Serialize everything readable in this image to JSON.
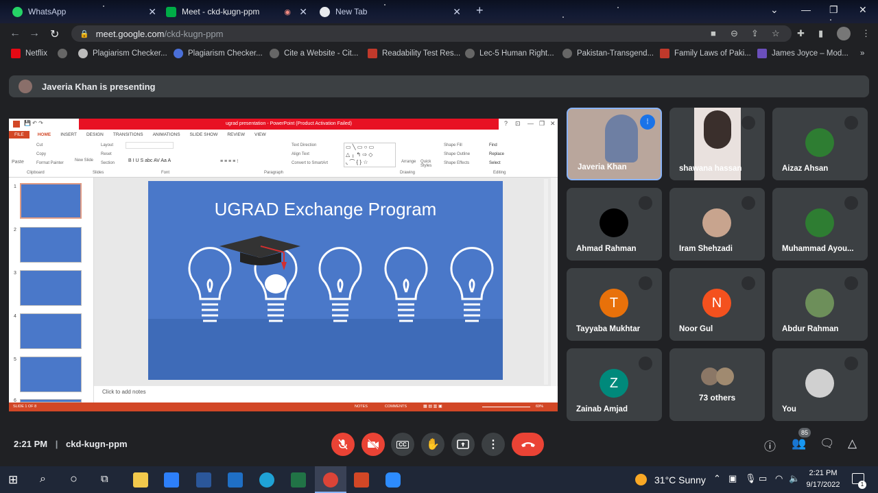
{
  "browser": {
    "tabs": [
      {
        "label": "WhatsApp",
        "favicon_color": "#25d366"
      },
      {
        "label": "Meet - ckd-kugn-ppm",
        "favicon_color": "#00ac47"
      },
      {
        "label": "New Tab",
        "favicon_color": "#e8eaed"
      }
    ],
    "url_host": "meet.google.com",
    "url_path": "/ckd-kugn-ppm",
    "bookmarks": [
      "Netflix",
      "Plagiarism Checker...",
      "Plagiarism Checker...",
      "Cite a Website - Cit...",
      "Readability Test Res...",
      "Lec-5 Human Right...",
      "Pakistan-Transgend...",
      "Family Laws of Paki...",
      "James Joyce – Mod..."
    ]
  },
  "meet": {
    "presenting_text": "Javeria Khan is presenting",
    "meeting_time": "2:21 PM",
    "meeting_code": "ckd-kugn-ppm",
    "participant_count": "85",
    "participants": [
      {
        "name": "Javeria Khan",
        "initial": "",
        "color": "#b9a69c",
        "speaking": true
      },
      {
        "name": "shawana hassan",
        "initial": "",
        "color": "#6b5a55"
      },
      {
        "name": "Aizaz Ahsan",
        "initial": "",
        "color": "#2e7d32"
      },
      {
        "name": "Ahmad Rahman",
        "initial": "",
        "color": "#000000"
      },
      {
        "name": "Iram Shehzadi",
        "initial": "",
        "color": "#c8a48e"
      },
      {
        "name": "Muhammad Ayou...",
        "initial": "",
        "color": "#2e7d32"
      },
      {
        "name": "Tayyaba Mukhtar",
        "initial": "T",
        "color": "#e8710a"
      },
      {
        "name": "Noor Gul",
        "initial": "N",
        "color": "#f4511e"
      },
      {
        "name": "Abdur Rahman",
        "initial": "",
        "color": "#6d8f5a"
      },
      {
        "name": "Zainab Amjad",
        "initial": "Z",
        "color": "#00897b"
      },
      {
        "name": "73 others",
        "initial": "",
        "color": "#8b7766"
      },
      {
        "name": "You",
        "initial": "",
        "color": "#d0d0d0"
      }
    ]
  },
  "powerpoint": {
    "window_title": "ugrad presentation - PowerPoint (Product Activation Failed)",
    "file_tab": "FILE",
    "tabs": [
      "HOME",
      "INSERT",
      "DESIGN",
      "TRANSITIONS",
      "ANIMATIONS",
      "SLIDE SHOW",
      "REVIEW",
      "VIEW"
    ],
    "ribbon_groups": [
      "Clipboard",
      "Slides",
      "Font",
      "Paragraph",
      "Drawing",
      "Editing"
    ],
    "ribbon_items": [
      "Cut",
      "Copy",
      "Format Painter",
      "Paste",
      "Layout",
      "Reset",
      "Section",
      "New Slide",
      "Text Direction",
      "Align Text",
      "Convert to SmartArt",
      "Arrange",
      "Quick Styles",
      "Shape Fill",
      "Shape Outline",
      "Shape Effects",
      "Find",
      "Replace",
      "Select"
    ],
    "slide_title": "UGRAD Exchange Program",
    "notes_placeholder": "Click to add notes",
    "status_left": "SLIDE 1 OF 8",
    "status_notes": "NOTES",
    "status_comments": "COMMENTS",
    "zoom": "69%",
    "thumbnail_numbers": [
      "1",
      "2",
      "3",
      "4",
      "5",
      "6"
    ]
  },
  "taskbar": {
    "temperature": "31°C",
    "weather": "Sunny",
    "time": "2:21 PM",
    "date": "9/17/2022",
    "notification_count": "1"
  },
  "colors": {
    "meet_bg": "#202124",
    "tile_bg": "#3c4043",
    "end_call": "#ea4335",
    "ppt_accent": "#d24726",
    "slide_blue": "#4a78c9"
  }
}
